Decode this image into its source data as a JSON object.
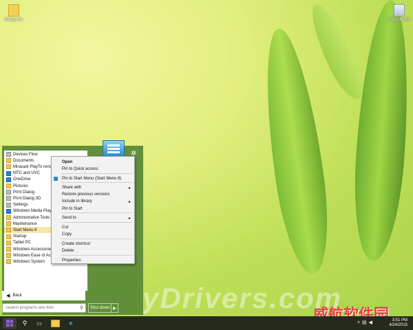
{
  "desktop": {
    "icons": [
      {
        "label": "Botiguelle",
        "icon": "folder-icon"
      },
      {
        "label": "Recycle Bin",
        "icon": "recycle-bin-icon"
      }
    ]
  },
  "start_menu": {
    "items": [
      {
        "label": "Devices Flow",
        "icon": "gear-icon"
      },
      {
        "label": "Documents",
        "icon": "folder-icon"
      },
      {
        "label": "Miracast PlayTo render",
        "icon": "folder-icon"
      },
      {
        "label": "MTC and UVC",
        "icon": "music-icon"
      },
      {
        "label": "OneDrive",
        "icon": "cloud-icon"
      },
      {
        "label": "Pictures",
        "icon": "folder-icon"
      },
      {
        "label": "Print Dialog",
        "icon": "printer-icon"
      },
      {
        "label": "Print Dialog 3D",
        "icon": "printer-icon"
      },
      {
        "label": "Settings",
        "icon": "gear-icon"
      },
      {
        "label": "Windows Media Player",
        "icon": "media-icon"
      },
      {
        "label": "Administrative Tools",
        "icon": "folder-icon"
      },
      {
        "label": "Maintenance",
        "icon": "folder-icon"
      },
      {
        "label": "Start Menu 8",
        "icon": "folder-icon"
      },
      {
        "label": "Startup",
        "icon": "folder-icon"
      },
      {
        "label": "Tablet PC",
        "icon": "folder-icon"
      },
      {
        "label": "Windows Accessories",
        "icon": "folder-icon"
      },
      {
        "label": "Windows Ease of Access",
        "icon": "folder-icon"
      },
      {
        "label": "Windows System",
        "icon": "folder-icon"
      }
    ],
    "selected_index": 12,
    "back_label": "Back",
    "search_placeholder": "Search programs and files",
    "shutdown_label": "Shut down"
  },
  "context_menu": {
    "items": [
      {
        "label": "Open",
        "bold": true
      },
      {
        "label": "Pin to Quick access"
      },
      {
        "label": "Pin to Start Menu (Start Menu 8)",
        "icon": true
      },
      {
        "label": "Share with",
        "submenu": true
      },
      {
        "label": "Restore previous versions"
      },
      {
        "label": "Include in library",
        "submenu": true
      },
      {
        "label": "Pin to Start"
      },
      {
        "label": "Send to",
        "submenu": true
      },
      {
        "label": "Cut"
      },
      {
        "label": "Copy"
      },
      {
        "label": "Create shortcut"
      },
      {
        "label": "Delete"
      },
      {
        "label": "Properties"
      }
    ]
  },
  "taskbar": {
    "time": "3:51 PM",
    "date": "4/24/2015"
  },
  "watermarks": {
    "site": "MyDrivers.com",
    "cn": "威航软件园"
  },
  "colors": {
    "start_menu_bg": "#628f3a",
    "taskbar_bg": "#262a1d",
    "selected_item": "#f6e7a9"
  }
}
